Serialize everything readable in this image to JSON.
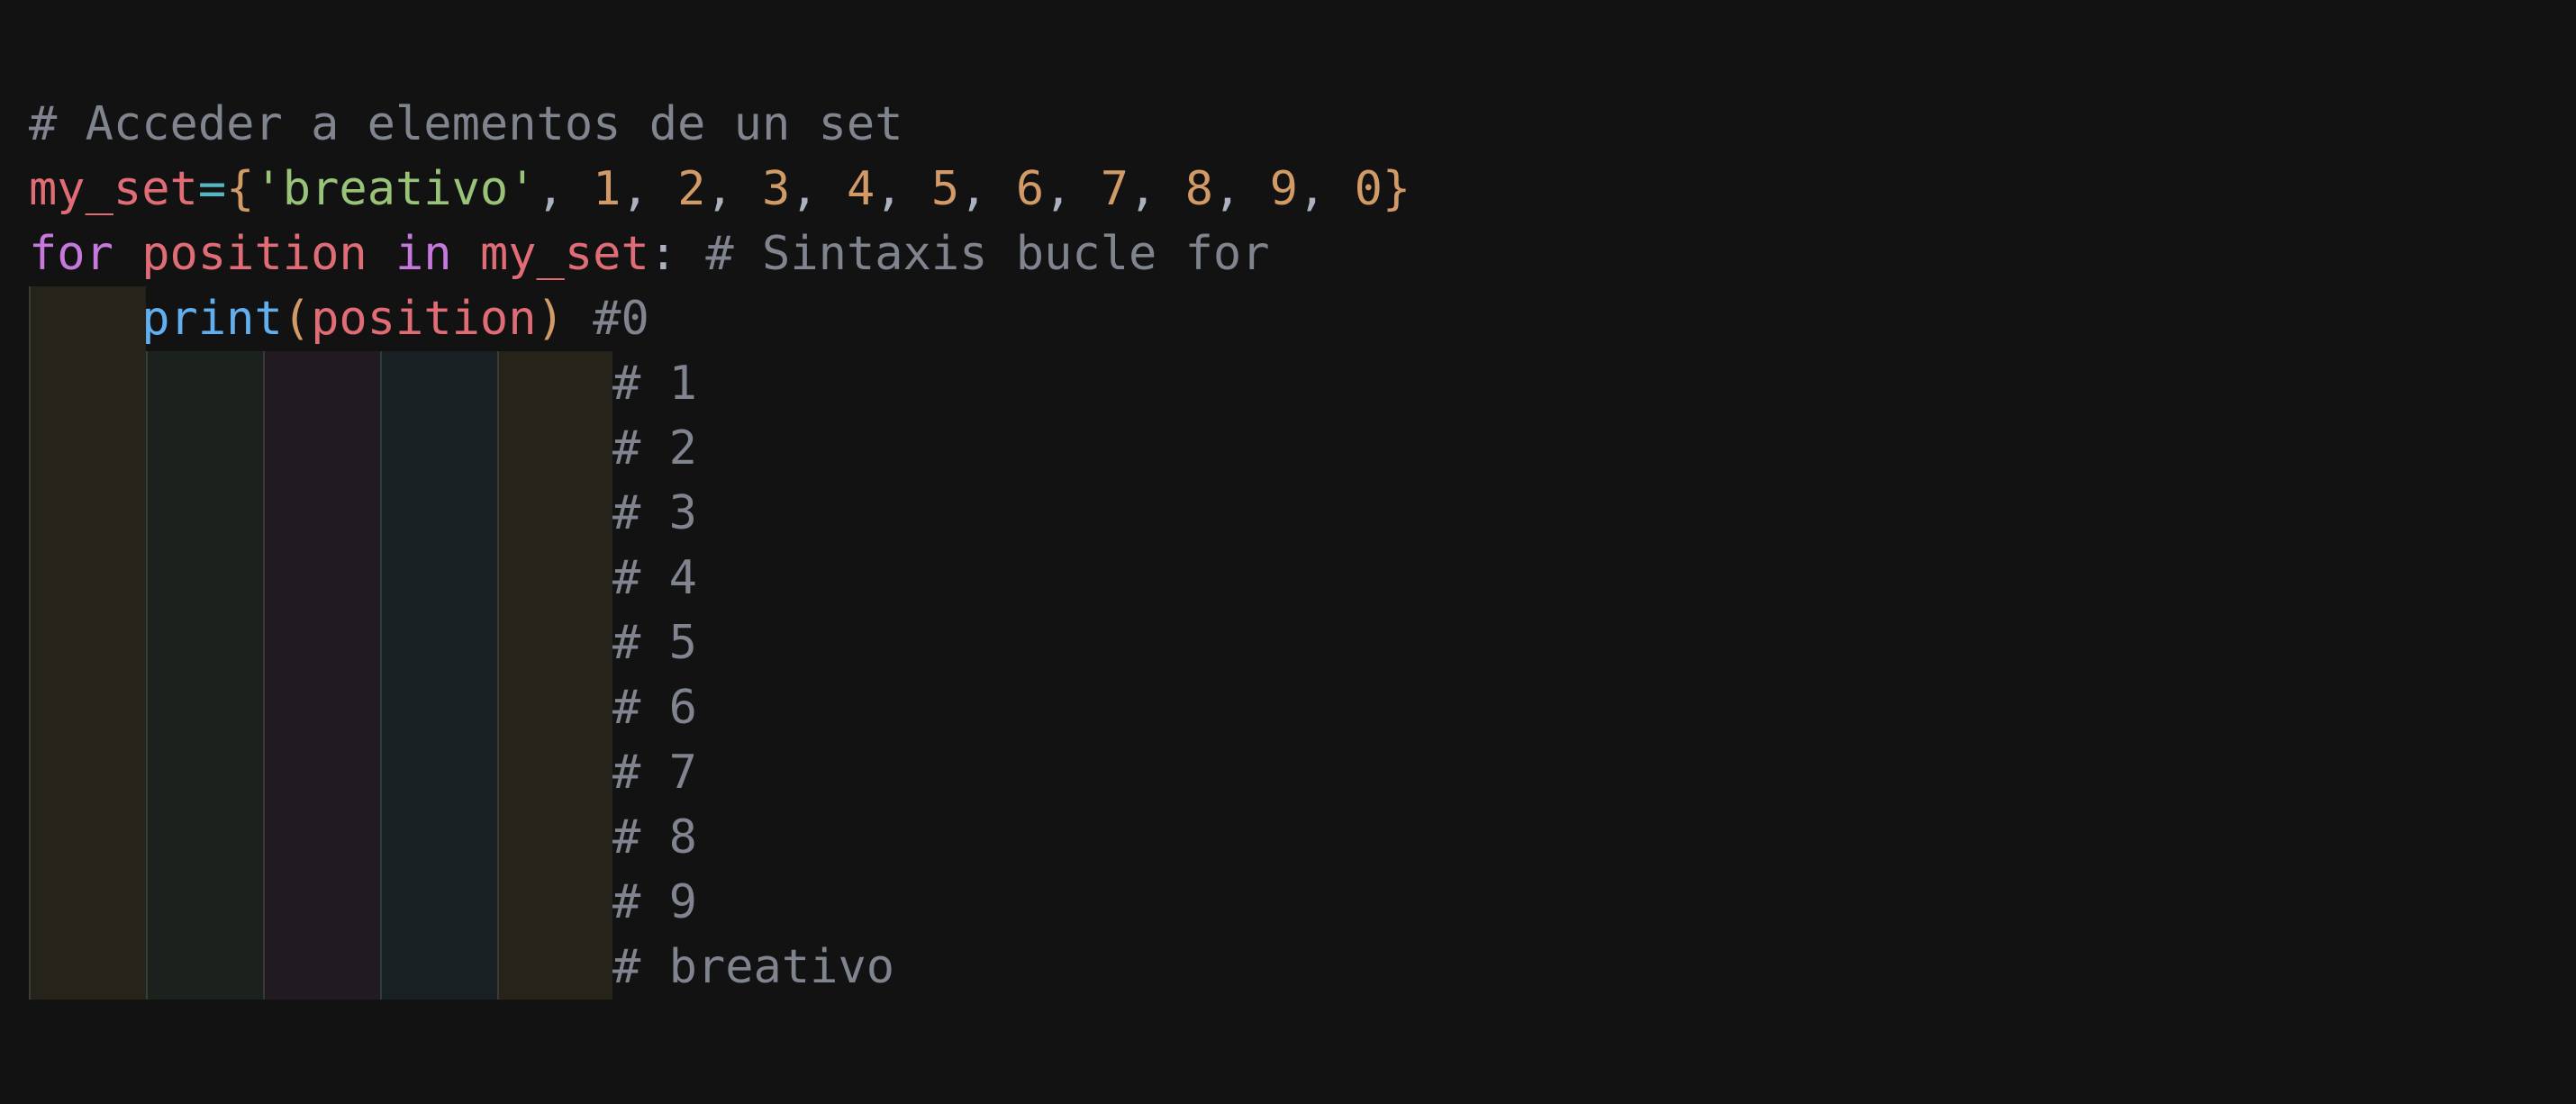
{
  "code": {
    "line1": {
      "comment": "# Acceder a elementos de un set"
    },
    "line2": {
      "var": "my_set",
      "op": "=",
      "open_brace": "{",
      "str": "'breativo'",
      "nums": [
        "1",
        "2",
        "3",
        "4",
        "5",
        "6",
        "7",
        "8",
        "9",
        "0"
      ],
      "sep": ", ",
      "close_brace": "}"
    },
    "line3": {
      "kw_for": "for",
      "var_position": "position",
      "kw_in": "in",
      "var_set": "my_set",
      "colon": ":",
      "comment": "# Sintaxis bucle for"
    },
    "line4": {
      "fn": "print",
      "open_paren": "(",
      "arg": "position",
      "close_paren": ")",
      "comment": "#0"
    },
    "output_comments": [
      "# 1",
      "# 2",
      "# 3",
      "# 4",
      "# 5",
      "# 6",
      "# 7",
      "# 8",
      "# 9",
      "# breativo"
    ]
  },
  "colors": {
    "background": "#121212",
    "comment": "#7f848e",
    "variable": "#e06c75",
    "string": "#98c379",
    "number": "#d19a66",
    "keyword": "#c678dd",
    "function": "#61afef",
    "operator": "#56b6c2"
  }
}
